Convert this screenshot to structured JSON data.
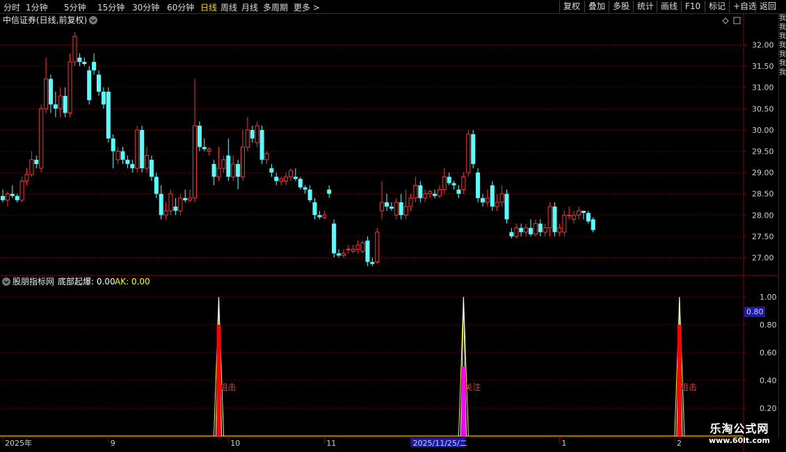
{
  "toolbar": {
    "periods": [
      "分时",
      "1分钟",
      "5分钟",
      "15分钟",
      "30分钟",
      "60分钟",
      "日线",
      "周线",
      "月线",
      "多周期",
      "更多 >"
    ],
    "active_period": "日线",
    "tools": [
      "复权",
      "叠加",
      "多股",
      "统计",
      "画线",
      "F10",
      "标记",
      "+自选",
      "返回"
    ]
  },
  "main_panel": {
    "title": "中信证券(日线,前复权)"
  },
  "indicator_panel": {
    "name": "股朋指标网",
    "values_text_a": "底部起爆: 0.00",
    "values_text_b": "AK: 0.00",
    "highlight_label": "0.80"
  },
  "watermark": {
    "line1": "乐淘公式网",
    "line2": "www.60lt.com"
  },
  "colors": {
    "up": "#ff3232",
    "down": "#54ffff",
    "grid": "#8b0000",
    "signal_red": "#ff0000",
    "signal_magenta": "#ff00ff",
    "signal_yellow": "#ffff00",
    "axis_text": "#d0d0d0"
  },
  "chart_data": [
    {
      "type": "candlestick",
      "title": "中信证券(日线,前复权)",
      "ylim": [
        26.6,
        32.4
      ],
      "y_ticks": [
        27.0,
        27.5,
        28.0,
        28.5,
        29.0,
        29.5,
        30.0,
        30.5,
        31.0,
        31.5,
        32.0
      ],
      "x_labels": [
        "2025年",
        "9",
        "10",
        "11",
        "2025/11/25/二",
        "1",
        "2"
      ],
      "ohlc": [
        [
          28.45,
          28.6,
          28.3,
          28.35
        ],
        [
          28.35,
          28.55,
          28.2,
          28.5
        ],
        [
          28.5,
          28.7,
          28.4,
          28.45
        ],
        [
          28.45,
          28.5,
          28.3,
          28.35
        ],
        [
          28.35,
          28.9,
          28.3,
          28.8
        ],
        [
          28.8,
          29.1,
          28.7,
          28.95
        ],
        [
          28.95,
          29.5,
          28.9,
          29.3
        ],
        [
          29.3,
          29.4,
          29.1,
          29.2
        ],
        [
          29.1,
          30.6,
          29.0,
          30.5
        ],
        [
          30.5,
          31.7,
          30.4,
          31.2
        ],
        [
          31.2,
          31.3,
          30.4,
          30.6
        ],
        [
          30.6,
          30.9,
          30.3,
          30.5
        ],
        [
          30.5,
          31.0,
          30.3,
          30.8
        ],
        [
          30.8,
          31.0,
          30.3,
          30.4
        ],
        [
          30.4,
          31.8,
          30.3,
          31.6
        ],
        [
          31.6,
          32.3,
          31.5,
          32.2
        ],
        [
          31.7,
          31.8,
          31.5,
          31.6
        ],
        [
          31.6,
          31.7,
          31.5,
          31.55
        ],
        [
          31.4,
          31.5,
          30.6,
          30.7
        ],
        [
          31.6,
          31.8,
          31.3,
          31.4
        ],
        [
          31.3,
          31.4,
          30.8,
          30.9
        ],
        [
          30.9,
          31.0,
          30.5,
          30.6
        ],
        [
          30.9,
          31.0,
          29.7,
          29.8
        ],
        [
          29.8,
          29.9,
          29.1,
          29.5
        ],
        [
          29.3,
          29.6,
          29.2,
          29.5
        ],
        [
          29.5,
          29.6,
          29.2,
          29.3
        ],
        [
          29.3,
          29.4,
          29.1,
          29.2
        ],
        [
          29.2,
          29.3,
          29.0,
          29.1
        ],
        [
          29.1,
          30.1,
          29.0,
          30.0
        ],
        [
          30.0,
          30.1,
          29.0,
          29.1
        ],
        [
          29.1,
          29.6,
          29.0,
          29.4
        ],
        [
          29.3,
          29.4,
          28.8,
          28.9
        ],
        [
          28.9,
          29.0,
          28.4,
          28.5
        ],
        [
          28.5,
          28.7,
          27.9,
          28.0
        ],
        [
          28.0,
          28.3,
          27.9,
          28.1
        ],
        [
          28.1,
          28.6,
          28.0,
          28.5
        ],
        [
          28.2,
          28.4,
          28.0,
          28.1
        ],
        [
          28.1,
          28.5,
          28.0,
          28.4
        ],
        [
          28.4,
          28.6,
          28.3,
          28.35
        ],
        [
          28.35,
          28.6,
          28.3,
          28.4
        ],
        [
          28.4,
          31.2,
          28.3,
          30.1
        ],
        [
          30.1,
          30.2,
          29.5,
          29.6
        ],
        [
          29.6,
          29.8,
          29.5,
          29.55
        ],
        [
          29.5,
          29.6,
          29.4,
          29.55
        ],
        [
          29.2,
          29.3,
          28.7,
          28.9
        ],
        [
          28.9,
          29.6,
          28.8,
          29.1
        ],
        [
          29.1,
          29.4,
          29.0,
          29.3
        ],
        [
          29.4,
          29.8,
          28.8,
          28.9
        ],
        [
          28.9,
          29.4,
          28.8,
          29.2
        ],
        [
          29.2,
          29.3,
          28.6,
          28.9
        ],
        [
          28.9,
          30.0,
          28.8,
          29.6
        ],
        [
          29.6,
          30.3,
          29.5,
          30.0
        ],
        [
          30.0,
          30.1,
          29.7,
          29.8
        ],
        [
          29.7,
          30.2,
          29.6,
          30.1
        ],
        [
          30.0,
          30.1,
          29.2,
          29.3
        ],
        [
          29.3,
          29.5,
          29.2,
          29.45
        ],
        [
          29.1,
          29.2,
          28.9,
          29.0
        ],
        [
          28.9,
          29.0,
          28.7,
          28.8
        ],
        [
          28.8,
          28.9,
          28.7,
          28.85
        ],
        [
          28.8,
          29.0,
          28.7,
          28.9
        ],
        [
          28.9,
          29.1,
          28.8,
          29.05
        ],
        [
          28.9,
          29.1,
          28.8,
          28.85
        ],
        [
          28.85,
          28.9,
          28.6,
          28.65
        ],
        [
          28.65,
          28.7,
          28.5,
          28.6
        ],
        [
          28.6,
          28.7,
          28.3,
          28.35
        ],
        [
          28.3,
          28.4,
          27.9,
          28.0
        ],
        [
          28.0,
          28.1,
          27.9,
          27.95
        ],
        [
          27.95,
          28.1,
          27.9,
          28.0
        ],
        [
          28.6,
          28.7,
          28.4,
          28.5
        ],
        [
          27.8,
          27.9,
          27.0,
          27.1
        ],
        [
          27.1,
          27.2,
          27.0,
          27.05
        ],
        [
          27.05,
          27.2,
          27.0,
          27.1
        ],
        [
          27.2,
          27.3,
          27.1,
          27.2
        ],
        [
          27.15,
          27.3,
          27.1,
          27.2
        ],
        [
          27.2,
          27.4,
          27.1,
          27.3
        ],
        [
          27.15,
          27.4,
          27.1,
          27.35
        ],
        [
          27.4,
          27.5,
          26.8,
          26.9
        ],
        [
          26.9,
          27.0,
          26.8,
          26.85
        ],
        [
          26.9,
          27.7,
          26.85,
          27.6
        ],
        [
          28.1,
          28.8,
          27.9,
          28.3
        ],
        [
          28.3,
          28.5,
          28.1,
          28.2
        ],
        [
          28.2,
          28.3,
          28.1,
          28.15
        ],
        [
          28.0,
          28.4,
          27.9,
          28.3
        ],
        [
          28.3,
          28.5,
          27.9,
          28.0
        ],
        [
          28.0,
          28.6,
          27.9,
          28.2
        ],
        [
          28.2,
          28.5,
          28.1,
          28.4
        ],
        [
          28.4,
          28.9,
          28.3,
          28.7
        ],
        [
          28.7,
          28.8,
          28.3,
          28.4
        ],
        [
          28.4,
          28.6,
          28.3,
          28.5
        ],
        [
          28.5,
          28.6,
          28.4,
          28.55
        ],
        [
          28.5,
          28.6,
          28.4,
          28.45
        ],
        [
          28.45,
          28.7,
          28.4,
          28.6
        ],
        [
          28.6,
          29.1,
          28.5,
          28.9
        ],
        [
          28.9,
          29.0,
          28.7,
          28.75
        ],
        [
          28.75,
          28.8,
          28.6,
          28.7
        ],
        [
          28.6,
          28.7,
          28.4,
          28.5
        ],
        [
          28.6,
          29.0,
          28.5,
          28.9
        ],
        [
          29.0,
          30.0,
          28.9,
          29.9
        ],
        [
          29.9,
          30.0,
          29.1,
          29.2
        ],
        [
          29.0,
          29.1,
          28.3,
          28.4
        ],
        [
          28.4,
          28.5,
          28.2,
          28.3
        ],
        [
          28.3,
          28.6,
          28.2,
          28.4
        ],
        [
          28.7,
          28.8,
          28.1,
          28.2
        ],
        [
          28.2,
          28.5,
          28.1,
          28.3
        ],
        [
          28.3,
          28.7,
          28.2,
          28.5
        ],
        [
          28.5,
          28.6,
          27.8,
          27.9
        ],
        [
          27.6,
          27.7,
          27.45,
          27.5
        ],
        [
          27.5,
          27.8,
          27.45,
          27.7
        ],
        [
          27.7,
          27.8,
          27.5,
          27.6
        ],
        [
          27.6,
          27.8,
          27.5,
          27.7
        ],
        [
          27.7,
          27.9,
          27.5,
          27.55
        ],
        [
          27.55,
          27.9,
          27.5,
          27.8
        ],
        [
          27.8,
          27.9,
          27.5,
          27.6
        ],
        [
          27.6,
          27.8,
          27.5,
          27.7
        ],
        [
          27.7,
          28.3,
          27.5,
          28.2
        ],
        [
          28.2,
          28.3,
          27.5,
          27.6
        ],
        [
          27.6,
          27.8,
          27.5,
          27.7
        ],
        [
          27.6,
          28.1,
          27.5,
          28.0
        ],
        [
          28.0,
          28.2,
          27.9,
          28.0
        ],
        [
          27.9,
          28.1,
          27.8,
          28.0
        ],
        [
          28.0,
          28.2,
          27.9,
          28.1
        ],
        [
          28.1,
          28.1,
          27.9,
          28.05
        ],
        [
          28.05,
          28.1,
          27.8,
          27.85
        ],
        [
          27.9,
          27.95,
          27.6,
          27.65
        ]
      ]
    },
    {
      "type": "line",
      "title": "股朋指标网",
      "ylim": [
        0,
        1.05
      ],
      "y_ticks": [
        0.2,
        0.4,
        0.6,
        0.8,
        1.0
      ],
      "series": [
        {
          "name": "底部起爆",
          "value_shown": 0.0,
          "spikes": [
            {
              "index": 45,
              "value": 1.0
            },
            {
              "index": 96,
              "value": 1.0
            },
            {
              "index": 141,
              "value": 1.0
            }
          ]
        },
        {
          "name": "AK",
          "value_shown": 0.0
        }
      ],
      "signal_bars": [
        {
          "index": 45,
          "value": 0.8,
          "color": "red",
          "label": "狙击"
        },
        {
          "index": 96,
          "value": 0.5,
          "color": "magenta",
          "label": "关注"
        },
        {
          "index": 141,
          "value": 0.8,
          "color": "red",
          "label": "狙击"
        }
      ]
    }
  ]
}
